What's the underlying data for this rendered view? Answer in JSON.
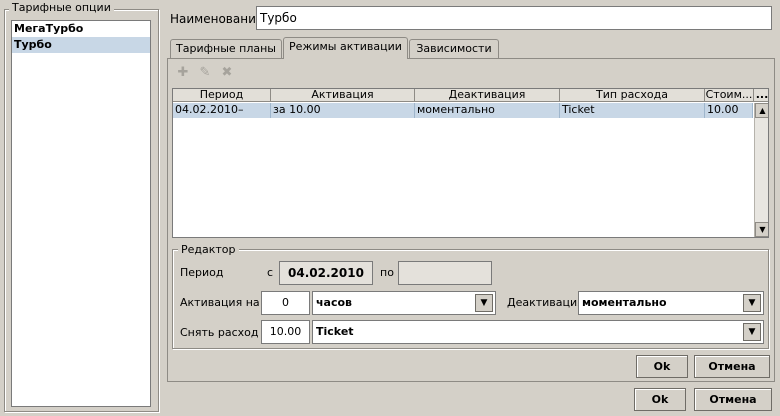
{
  "left_panel": {
    "title": "Тарифные опции",
    "items": [
      "МегаТурбо",
      "Турбо"
    ]
  },
  "name_field": {
    "label": "Наименование",
    "value": "Турбо"
  },
  "tabs": [
    "Тарифные планы",
    "Режимы активации",
    "Зависимости"
  ],
  "toolbar": {
    "icons": [
      "add-icon",
      "edit-icon",
      "delete-icon"
    ]
  },
  "table": {
    "columns": [
      "Период",
      "Активация",
      "Деактивация",
      "Тип расхода",
      "Стоим...",
      "..."
    ],
    "rows": [
      [
        "04.02.2010–",
        "за 10.00",
        "моментально",
        "Ticket",
        "10.00"
      ]
    ]
  },
  "editor": {
    "title": "Редактор",
    "period_label": "Период",
    "from_label": "с",
    "from_value": "04.02.2010",
    "to_label": "по",
    "to_value": "",
    "activation_label": "Активация на",
    "activation_value": "0",
    "activation_unit": "часов",
    "deactivation_label": "Деактивация",
    "deactivation_value": "моментально",
    "charge_label": "Снять расход",
    "charge_value": "10.00",
    "charge_type": "Ticket"
  },
  "inner_buttons": {
    "ok": "Ok",
    "cancel": "Отмена"
  },
  "outer_buttons": {
    "ok": "Ok",
    "cancel": "Отмена"
  }
}
